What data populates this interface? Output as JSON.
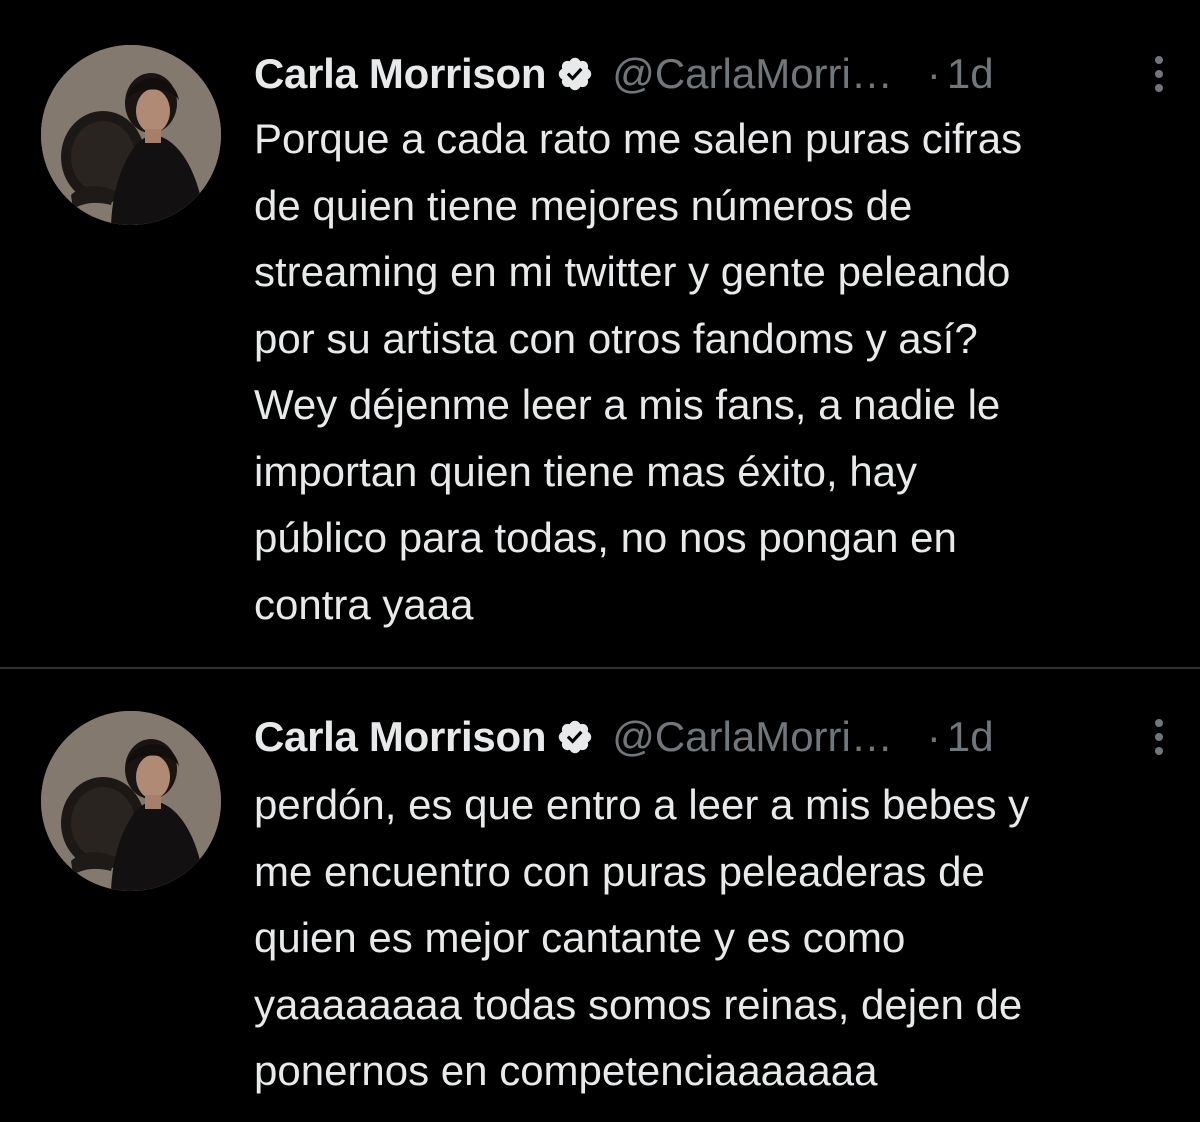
{
  "tweets": [
    {
      "author": {
        "display_name": "Carla Morrison",
        "verified_icon": "verified-badge-icon",
        "handle": "@CarlaMorri…"
      },
      "separator": "·",
      "time": "1d",
      "more_icon": "more-vertical-icon",
      "text": "Porque a cada rato me salen puras cifras\nde quien tiene mejores números de\nstreaming en mi twitter y gente peleando\npor su artista con otros fandoms y así?\nWey déjenme leer a mis fans, a nadie le\nimportan quien tiene mas éxito, hay\npúblico para todas, no nos pongan en\ncontra yaaa"
    },
    {
      "author": {
        "display_name": "Carla Morrison",
        "verified_icon": "verified-badge-icon",
        "handle": "@CarlaMorri…"
      },
      "separator": "·",
      "time": "1d",
      "more_icon": "more-vertical-icon",
      "text": "perdón, es que entro a leer a mis bebes y\nme encuentro con puras peleaderas de\nquien es mejor cantante y es como\nyaaaaaaaa todas somos reinas, dejen de\nponernos en competenciaaaaaaa"
    }
  ],
  "colors": {
    "background": "#000000",
    "primary_text": "#e7e9ea",
    "secondary_text": "#71767b",
    "divider": "#2f3336"
  }
}
